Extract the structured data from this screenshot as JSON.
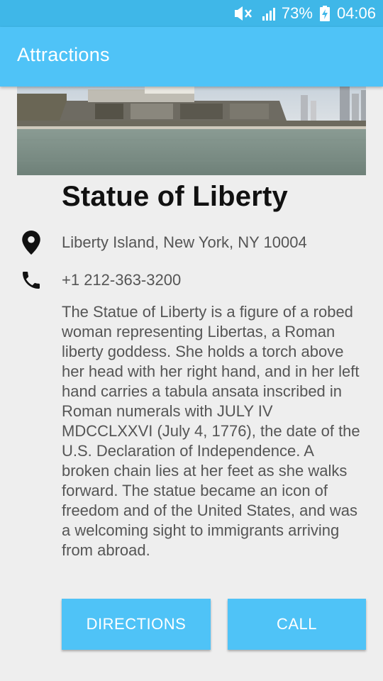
{
  "status_bar": {
    "battery_percent": "73%",
    "time": "04:06",
    "icons": [
      "mute-icon",
      "signal-icon",
      "battery-charging-icon"
    ]
  },
  "app_bar": {
    "title": "Attractions"
  },
  "colors": {
    "status_bar": "#3fb7e8",
    "app_bar": "#4fc3f7",
    "button": "#4fc3f7",
    "background": "#eeeeee"
  },
  "attraction": {
    "name": "Statue of Liberty",
    "address": "Liberty Island, New York, NY 10004",
    "phone": "+1 212-363-3200",
    "description": "The Statue of Liberty is a figure of a robed woman representing Libertas, a Roman liberty goddess. She holds a torch above her head with her right hand, and in her left hand carries a tabula ansata inscribed in Roman numerals with JULY IV MDCCLXXVI (July 4, 1776), the date of the U.S. Declaration of Independence. A broken chain lies at her feet as she walks forward. The statue became an icon of freedom and of the United States, and was a welcoming sight to immigrants arriving from abroad."
  },
  "actions": {
    "directions_label": "DIRECTIONS",
    "call_label": "CALL"
  }
}
